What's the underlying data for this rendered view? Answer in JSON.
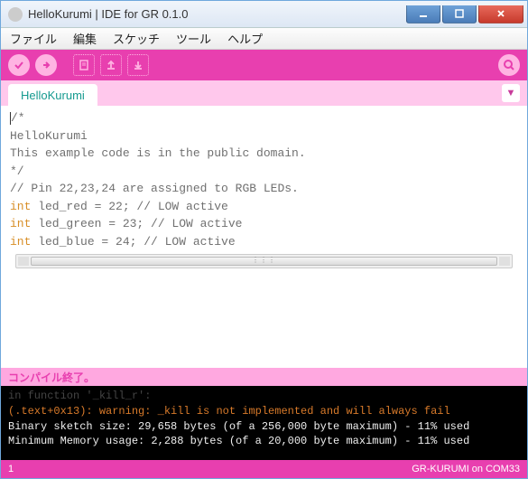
{
  "window": {
    "title": "HelloKurumi | IDE for GR 0.1.0"
  },
  "menubar": {
    "file": "ファイル",
    "edit": "編集",
    "sketch": "スケッチ",
    "tools": "ツール",
    "help": "ヘルプ"
  },
  "tabs": {
    "active": "HelloKurumi"
  },
  "code": {
    "l1": "/*",
    "l2": "  HelloKurumi",
    "l3": "",
    "l4": "  This example code is in the public domain.",
    "l5": " */",
    "l6": "",
    "l7": "// Pin 22,23,24 are assigned to RGB LEDs.",
    "l8a": "int",
    "l8b": " led_red   = 22; // LOW active",
    "l9a": "int",
    "l9b": " led_green = 23; // LOW active",
    "l10a": "int",
    "l10b": " led_blue  = 24; // LOW active"
  },
  "status_compile": "コンパイル終了。",
  "console": {
    "l0": "in function '_kill_r':",
    "l1": "(.text+0x13): warning: _kill is not implemented and will always fail",
    "l2": "Binary sketch size: 29,658 bytes (of a 256,000 byte maximum) - 11% used",
    "l3": "Minimum Memory usage: 2,288 bytes (of a 20,000 byte maximum) - 11% used"
  },
  "statusbar": {
    "line": "1",
    "board": "GR-KURUMI on COM33"
  }
}
